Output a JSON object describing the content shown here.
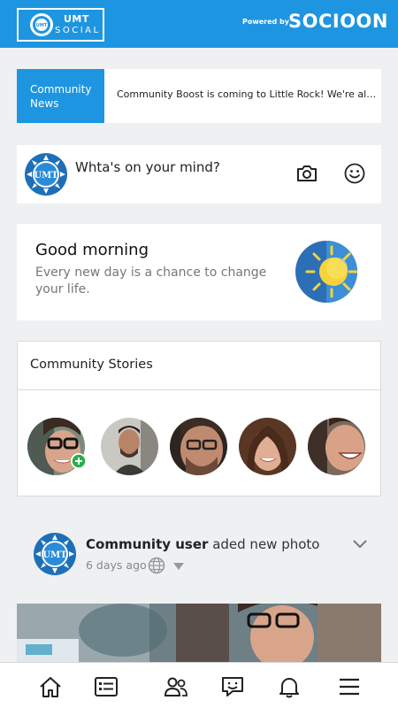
{
  "header": {
    "logo_title": "UMT",
    "logo_subtitle": "SOCIAL",
    "logo_seal_text": "UMT",
    "powered_by": "Powered by",
    "brand": "SOCIOON",
    "color": "#1e95e0"
  },
  "news": {
    "tag_line1": "Community",
    "tag_line2": "News",
    "headline": "Community Boost is coming to Little Rock! We're also..."
  },
  "composer": {
    "placeholder": "Whta's on your mind?",
    "camera_icon": "camera-icon",
    "emoji_icon": "smiley-icon"
  },
  "greeting": {
    "title": "Good morning",
    "text": "Every new day is a chance to change your life.",
    "icon": "sun-icon"
  },
  "stories": {
    "title": "Community Stories",
    "items": [
      {
        "name": "own-story",
        "add": true
      },
      {
        "name": "story-2"
      },
      {
        "name": "story-3"
      },
      {
        "name": "story-4"
      },
      {
        "name": "story-5"
      }
    ]
  },
  "feed": {
    "user": "Community user",
    "action": "aded new photo",
    "time": "6 days ago",
    "privacy_icon": "globe-icon"
  },
  "tabbar": {
    "items": [
      "home-icon",
      "feed-list-icon",
      "friends-icon",
      "messages-icon",
      "notifications-icon",
      "menu-icon"
    ]
  }
}
